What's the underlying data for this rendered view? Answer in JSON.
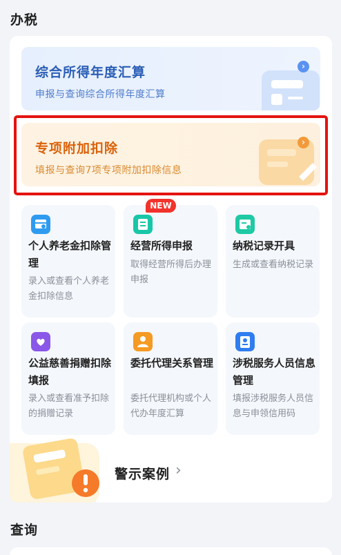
{
  "sections": {
    "banshui": "办税",
    "chaxun": "查询"
  },
  "banners": [
    {
      "title": "综合所得年度汇算",
      "desc": "申报与查询综合所得年度汇算"
    },
    {
      "title": "专项附加扣除",
      "desc": "填报与查询7项专项附加扣除信息"
    }
  ],
  "cards": [
    {
      "title": "个人养老金扣除管理",
      "desc": "录入或查看个人养老金扣除信息",
      "icon": "pension-card-icon",
      "color": "#2f9bf0"
    },
    {
      "title": "经营所得申报",
      "desc": "取得经营所得后办理申报",
      "icon": "business-income-icon",
      "color": "#18c6a8",
      "badge": "NEW"
    },
    {
      "title": "纳税记录开具",
      "desc": "生成或查看纳税记录",
      "icon": "tax-record-icon",
      "color": "#1ec9a4"
    },
    {
      "title": "公益慈善捐赠扣除填报",
      "desc": "录入或查看准予扣除的捐赠记录",
      "icon": "charity-donation-icon",
      "color": "#8a57e8"
    },
    {
      "title": "委托代理关系管理",
      "desc": "委托代理机构或个人代办年度汇算",
      "icon": "agent-delegation-icon",
      "color": "#f59a23"
    },
    {
      "title": "涉税服务人员信息管理",
      "desc": "填报涉税服务人员信息与申领信用码",
      "icon": "service-staff-icon",
      "color": "#2f7df0"
    }
  ],
  "warning": {
    "label": "警示案例"
  },
  "colors": {
    "highlight": "#e4130f",
    "new_badge": "#f2322c"
  }
}
